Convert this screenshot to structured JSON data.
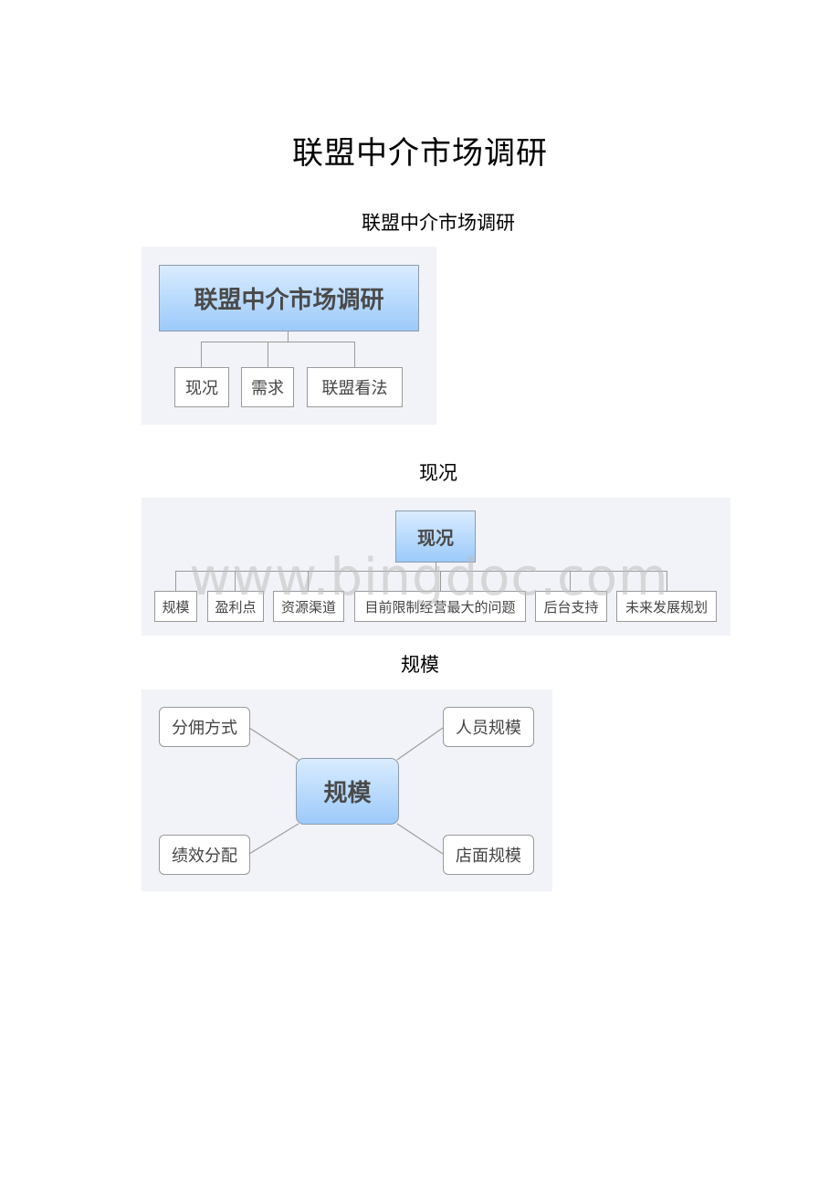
{
  "document": {
    "title": "联盟中介市场调研"
  },
  "sections": [
    {
      "caption": "联盟中介市场调研",
      "root": "联盟中介市场调研",
      "children": [
        "现况",
        "需求",
        "联盟看法"
      ]
    },
    {
      "caption": "现况",
      "root": "现况",
      "children": [
        "规模",
        "盈利点",
        "资源渠道",
        "目前限制经营最大的问题",
        "后台支持",
        "未来发展规划"
      ]
    },
    {
      "caption": "规模",
      "root": "规模",
      "children": [
        "分佣方式",
        "人员规模",
        "绩效分配",
        "店面规模"
      ]
    }
  ],
  "watermark": "www.bingdoc.com"
}
